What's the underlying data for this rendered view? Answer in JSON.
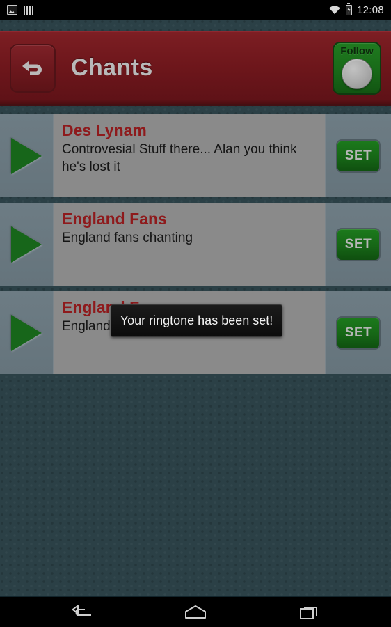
{
  "status_bar": {
    "clock": "12:08",
    "left_icons": [
      "screenshot-icon",
      "bars-icon"
    ],
    "right_icons": [
      "wifi-icon",
      "battery-charging-icon"
    ]
  },
  "header": {
    "title": "Chants",
    "back_icon": "back-arrow-icon",
    "follow_label": "Follow"
  },
  "list": {
    "items": [
      {
        "title": "Des Lynam",
        "description": "Controvesial Stuff there... Alan you think he's lost it",
        "play_icon": "play-icon",
        "set_label": "SET"
      },
      {
        "title": "England Fans",
        "description": "England fans chanting",
        "play_icon": "play-icon",
        "set_label": "SET"
      },
      {
        "title": "England Fans",
        "description": "England fans chanting",
        "play_icon": "play-icon",
        "set_label": "SET"
      }
    ]
  },
  "toast": {
    "message": "Your ringtone has been set!"
  },
  "nav_bar": {
    "back": "nav-back-icon",
    "home": "nav-home-icon",
    "recents": "nav-recents-icon"
  },
  "colors": {
    "header_red": "#6d161b",
    "title_red": "#8e1a1c",
    "accent_green": "#176617",
    "panel_gray": "#8a8a8a",
    "backdrop": "#2b4046",
    "toast_bg": "#0b0b0b"
  }
}
